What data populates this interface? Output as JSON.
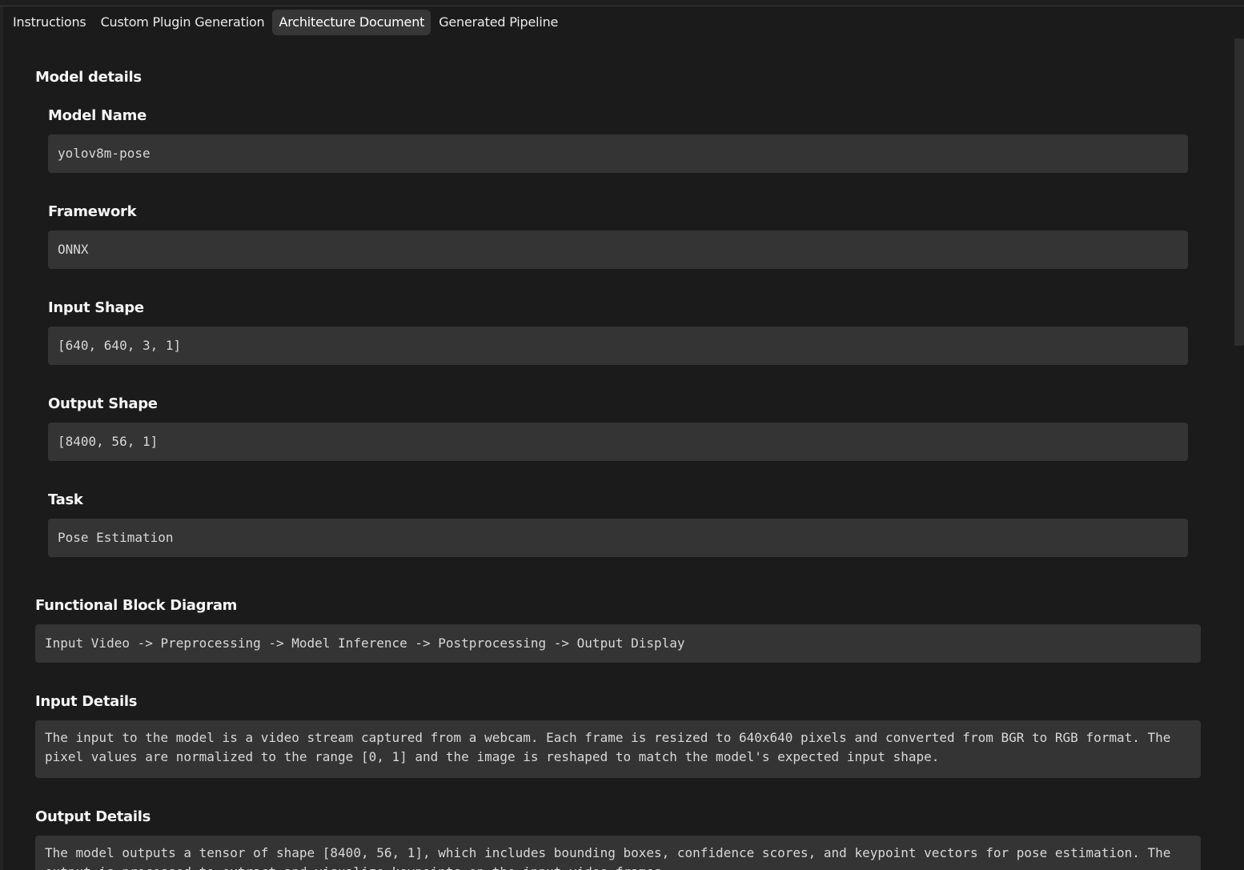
{
  "tabs": [
    {
      "label": "Instructions",
      "active": false
    },
    {
      "label": "Custom Plugin Generation",
      "active": false
    },
    {
      "label": "Architecture Document",
      "active": true
    },
    {
      "label": "Generated Pipeline",
      "active": false
    }
  ],
  "model_details": {
    "title": "Model details",
    "fields": [
      {
        "label": "Model Name",
        "value": "yolov8m-pose"
      },
      {
        "label": "Framework",
        "value": "ONNX"
      },
      {
        "label": "Input Shape",
        "value": "[640, 640, 3, 1]"
      },
      {
        "label": "Output Shape",
        "value": "[8400, 56, 1]"
      },
      {
        "label": "Task",
        "value": "Pose Estimation"
      }
    ]
  },
  "functional_block_diagram": {
    "title": "Functional Block Diagram",
    "value": "Input Video -> Preprocessing -> Model Inference -> Postprocessing -> Output Display"
  },
  "input_details": {
    "title": "Input Details",
    "value": "The input to the model is a video stream captured from a webcam. Each frame is resized to 640x640 pixels and converted from BGR to RGB format. The pixel values are normalized to the range [0, 1] and the image is reshaped to match the model's expected input shape."
  },
  "output_details": {
    "title": "Output Details",
    "value": "The model outputs a tensor of shape [8400, 56, 1], which includes bounding boxes, confidence scores, and keypoint vectors for pose estimation. The output is processed to extract and visualize keypoints on the input video frames."
  }
}
